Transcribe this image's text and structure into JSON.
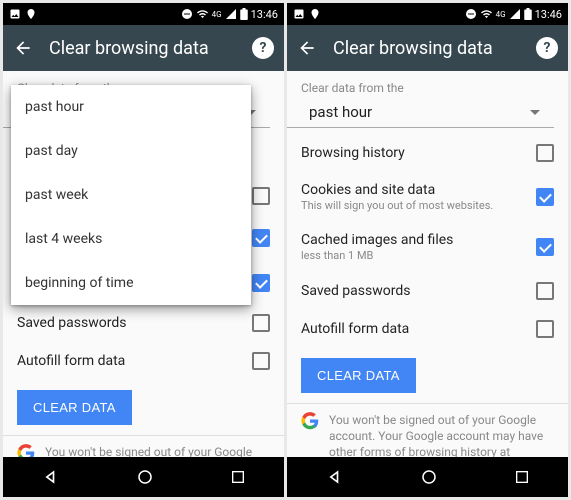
{
  "status": {
    "time": "13:46"
  },
  "appbar": {
    "title": "Clear browsing data"
  },
  "section_label": "Clear data from the",
  "time_range": {
    "selected": "past hour",
    "options": [
      "past hour",
      "past day",
      "past week",
      "last 4 weeks",
      "beginning of time"
    ]
  },
  "options": {
    "browsing_history": {
      "title": "Browsing history",
      "checked": false
    },
    "cookies": {
      "title": "Cookies and site data",
      "sub": "This will sign you out of most websites.",
      "checked": true
    },
    "cached": {
      "title": "Cached images and files",
      "sub": "less than 1 MB",
      "checked": true
    },
    "saved_passwords": {
      "title": "Saved passwords",
      "checked": false
    },
    "autofill": {
      "title": "Autofill form data",
      "checked": false
    }
  },
  "clear_button": "CLEAR DATA",
  "info_text": "You won't be signed out of your Google account. Your Google account may have other forms of browsing history at"
}
